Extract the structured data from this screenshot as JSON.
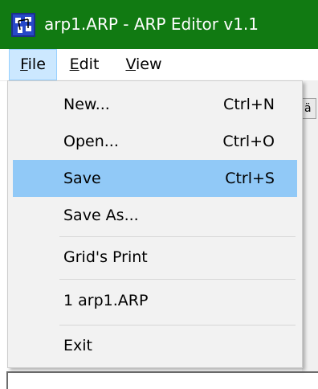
{
  "window": {
    "title": "arp1.ARP - ARP Editor v1.1",
    "icon": "arp-editor-app-icon",
    "titlebar_color": "#117a12"
  },
  "menubar": {
    "items": [
      {
        "label": "File",
        "mnemonic": "F",
        "rest": "ile",
        "active": true
      },
      {
        "label": "Edit",
        "mnemonic": "E",
        "rest": "dit",
        "active": false
      },
      {
        "label": "View",
        "mnemonic": "V",
        "rest": "iew",
        "active": false
      }
    ]
  },
  "file_menu": {
    "highlight_color": "#91c9f7",
    "items": [
      {
        "label": "New...",
        "shortcut": "Ctrl+N"
      },
      {
        "label": "Open...",
        "shortcut": "Ctrl+O"
      },
      {
        "label": "Save",
        "shortcut": "Ctrl+S",
        "highlighted": true
      },
      {
        "label": "Save As...",
        "shortcut": ""
      },
      {
        "label": "Grid's Print",
        "shortcut": ""
      },
      {
        "label": "1 arp1.ARP",
        "shortcut": ""
      },
      {
        "label": "Exit",
        "shortcut": ""
      }
    ]
  }
}
